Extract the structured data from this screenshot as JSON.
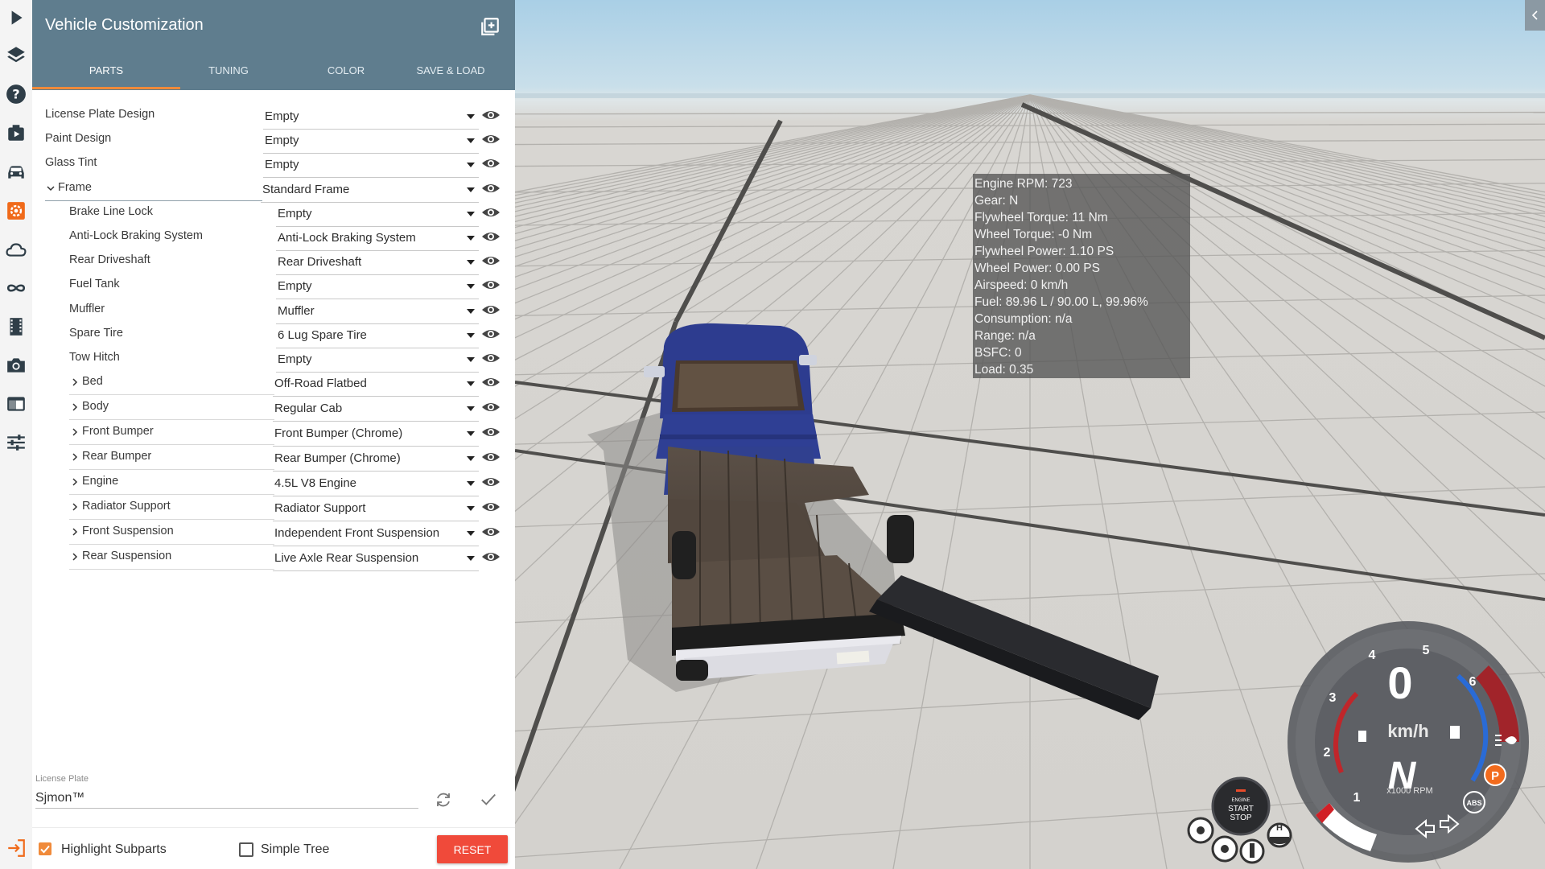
{
  "panel": {
    "title": "Vehicle Customization",
    "tabs": [
      {
        "label": "PARTS",
        "active": true
      },
      {
        "label": "TUNING",
        "active": false
      },
      {
        "label": "COLOR",
        "active": false
      },
      {
        "label": "SAVE & LOAD",
        "active": false
      }
    ]
  },
  "rail_icons": [
    "play-icon",
    "layers-icon",
    "help-icon",
    "scenario-icon",
    "car-icon",
    "gear-icon",
    "cloud-icon",
    "infinity-icon",
    "film-icon",
    "camera-icon",
    "window-icon",
    "sliders-icon",
    "exit-icon"
  ],
  "parts": [
    {
      "label": "License Plate Design",
      "value": "Empty",
      "level": 0,
      "expander": "none"
    },
    {
      "label": "Paint Design",
      "value": "Empty",
      "level": 0,
      "expander": "none"
    },
    {
      "label": "Glass Tint",
      "value": "Empty",
      "level": 0,
      "expander": "none"
    },
    {
      "label": "Frame",
      "value": "Standard Frame",
      "level": 0,
      "expander": "open"
    },
    {
      "label": "Brake Line Lock",
      "value": "Empty",
      "level": 1,
      "expander": "none"
    },
    {
      "label": "Anti-Lock Braking System",
      "value": "Anti-Lock Braking System",
      "level": 1,
      "expander": "none"
    },
    {
      "label": "Rear Driveshaft",
      "value": "Rear Driveshaft",
      "level": 1,
      "expander": "none"
    },
    {
      "label": "Fuel Tank",
      "value": "Empty",
      "level": 1,
      "expander": "none"
    },
    {
      "label": "Muffler",
      "value": "Muffler",
      "level": 1,
      "expander": "none"
    },
    {
      "label": "Spare Tire",
      "value": "6 Lug Spare Tire",
      "level": 1,
      "expander": "none"
    },
    {
      "label": "Tow Hitch",
      "value": "Empty",
      "level": 1,
      "expander": "none"
    },
    {
      "label": "Bed",
      "value": "Off-Road Flatbed",
      "level": 1,
      "expander": "closed"
    },
    {
      "label": "Body",
      "value": "Regular Cab",
      "level": 1,
      "expander": "closed"
    },
    {
      "label": "Front Bumper",
      "value": "Front Bumper (Chrome)",
      "level": 1,
      "expander": "closed"
    },
    {
      "label": "Rear Bumper",
      "value": "Rear Bumper (Chrome)",
      "level": 1,
      "expander": "closed"
    },
    {
      "label": "Engine",
      "value": "4.5L V8 Engine",
      "level": 1,
      "expander": "closed"
    },
    {
      "label": "Radiator Support",
      "value": "Radiator Support",
      "level": 1,
      "expander": "closed"
    },
    {
      "label": "Front Suspension",
      "value": "Independent Front Suspension",
      "level": 1,
      "expander": "closed"
    },
    {
      "label": "Rear Suspension",
      "value": "Live Axle Rear Suspension",
      "level": 1,
      "expander": "closed"
    }
  ],
  "license_plate": {
    "caption": "License Plate",
    "value": "Sjmon™"
  },
  "footer": {
    "highlight_label": "Highlight Subparts",
    "highlight_checked": true,
    "simple_label": "Simple Tree",
    "simple_checked": false,
    "reset_label": "RESET"
  },
  "telemetry": [
    "Engine RPM: 723",
    "Gear: N",
    "Flywheel Torque: 11 Nm",
    "Wheel Torque: -0 Nm",
    "Flywheel Power: 1.10 PS",
    "Wheel Power: 0.00 PS",
    "Airspeed: 0 km/h",
    "Fuel: 89.96 L / 90.00 L, 99.96%",
    "Consumption: n/a",
    "Range: n/a",
    "BSFC: 0",
    "Load: 0.35"
  ],
  "gauge": {
    "speed": "0",
    "speed_unit": "km/h",
    "gear": "N",
    "rpm_unit": "x1000 RPM",
    "tach_labels": [
      "1",
      "2",
      "3",
      "4",
      "5",
      "6"
    ],
    "parking_label": "P",
    "abs_label": "ABS",
    "start_stop": {
      "line1": "ENGINE",
      "line2": "START",
      "line3": "STOP"
    },
    "handbrake_label": "H",
    "accent_red": "#c0262a",
    "accent_blue": "#2a6bd6",
    "accent_orange": "#f26b1d"
  },
  "colors": {
    "header": "#5f7d8e",
    "tab_underline": "#f08a3a",
    "reset": "#f04a3a",
    "rail_accent": "#f06a1a"
  }
}
